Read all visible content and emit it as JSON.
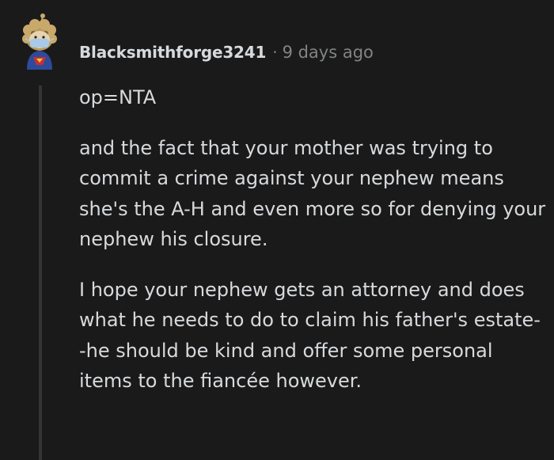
{
  "comment": {
    "author": "Blacksmithforge3241",
    "separator": "·",
    "timestamp": "9 days ago",
    "avatar_icon": "snoo-avatar-icon",
    "paragraphs": [
      "op=NTA",
      "and the fact that your mother was trying to commit a crime against your nephew means she's the A-H and even more so for denying your nephew his closure.",
      "I hope your nephew gets an attorney and does what he needs to do to claim his father's estate--he should be kind and offer some personal items to the fiancée however."
    ]
  },
  "colors": {
    "background": "#1a1a1b",
    "text": "#d7dadc",
    "meta": "#818384",
    "thread_line": "#343536"
  }
}
